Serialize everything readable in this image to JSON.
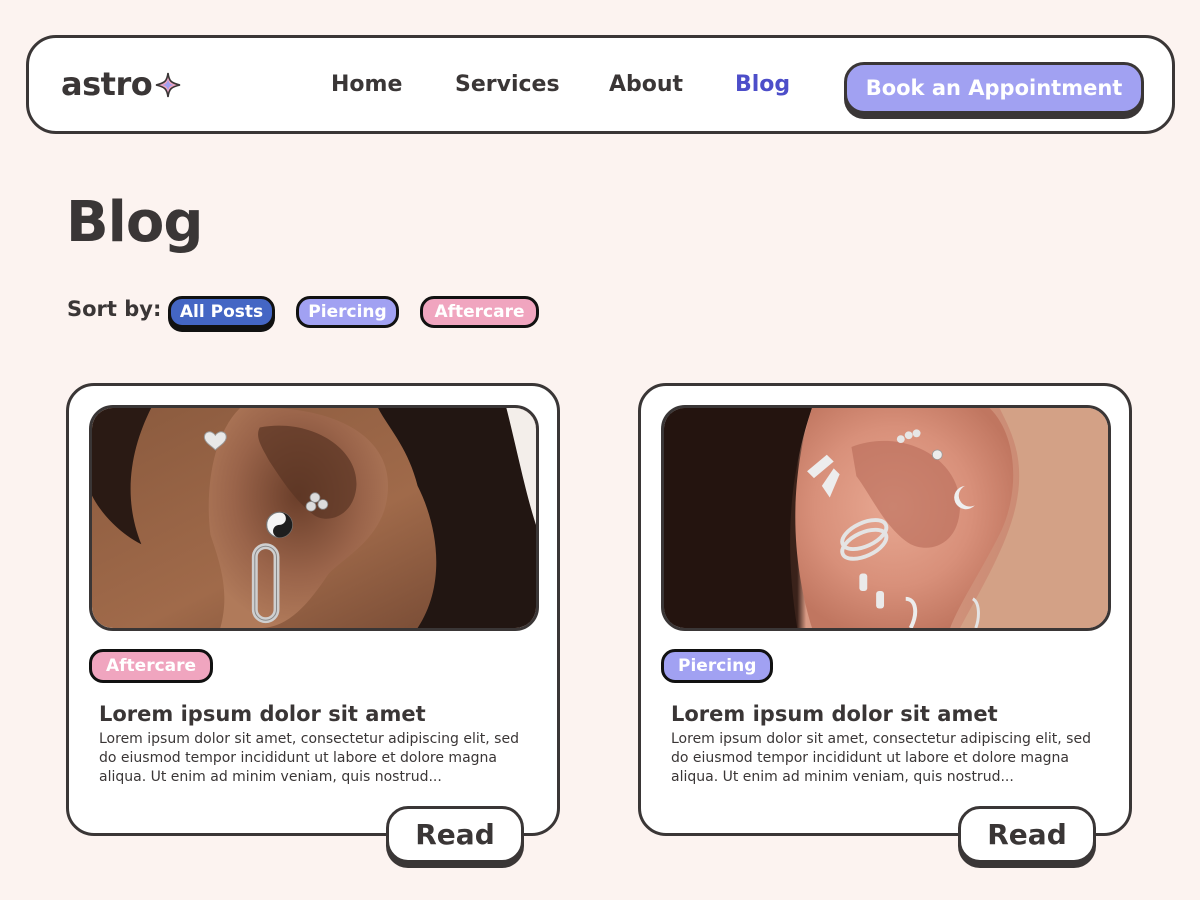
{
  "nav": {
    "logo": "astro",
    "links": [
      {
        "label": "Home"
      },
      {
        "label": "Services"
      },
      {
        "label": "About"
      },
      {
        "label": "Blog",
        "active": true
      }
    ],
    "cta": "Book an Appointment"
  },
  "header": {
    "title": "Blog",
    "sort_label": "Sort by:",
    "filters": [
      "All Posts",
      "Piercing",
      "Aftercare"
    ],
    "active_filter": "All Posts"
  },
  "posts": [
    {
      "tag": "Aftercare",
      "title": "Lorem ipsum dolor sit amet",
      "excerpt": "Lorem ipsum dolor sit amet, consectetur adipiscing elit, sed do eiusmod tempor incididunt ut labore et dolore magna aliqua. Ut enim ad minim veniam, quis nostrud...",
      "read_label": "Read"
    },
    {
      "tag": "Piercing",
      "title": "Lorem ipsum dolor sit amet",
      "excerpt": "Lorem ipsum dolor sit amet, consectetur adipiscing elit, sed do eiusmod tempor incididunt ut labore et dolore magna aliqua. Ut enim ad minim veniam, quis nostrud...",
      "read_label": "Read"
    }
  ],
  "colors": {
    "background": "#fcf3f0",
    "ink": "#3a3636",
    "lavender": "#a1a1f2",
    "pink": "#f0a5bf",
    "blue": "#4466c4",
    "active_link": "#4d4ec9"
  },
  "icons": {
    "logo_star": "sparkle-star-icon"
  }
}
